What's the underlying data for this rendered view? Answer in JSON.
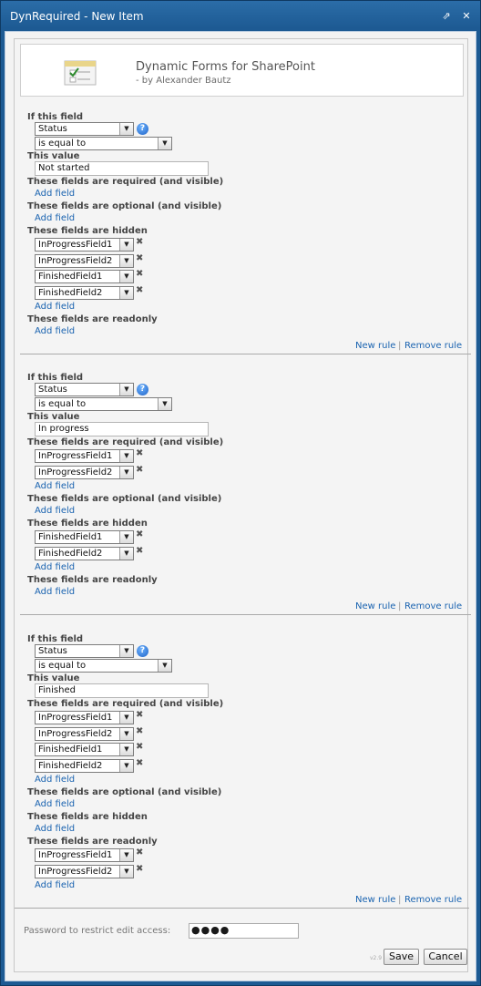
{
  "window": {
    "title": "DynRequired - New Item"
  },
  "banner": {
    "title": "Dynamic Forms for SharePoint",
    "subtitle": "- by Alexander Bautz"
  },
  "labels": {
    "if_field": "If this field",
    "this_value": "This value",
    "required": "These fields are required (and visible)",
    "optional": "These fields are optional (and visible)",
    "hidden": "These fields are hidden",
    "readonly": "These fields are readonly",
    "add_field": "Add field",
    "new_rule": "New rule",
    "remove_rule": "Remove rule",
    "sep": "|"
  },
  "icons": {
    "help": "?",
    "remove": "✖",
    "dropdown": "▼",
    "popout": "⇗",
    "close": "✕"
  },
  "rules": [
    {
      "field": "Status",
      "operator": "is equal to",
      "value": "Not started",
      "required": [],
      "optional": [],
      "hidden": [
        "InProgressField1",
        "InProgressField2",
        "FinishedField1",
        "FinishedField2"
      ],
      "readonly": []
    },
    {
      "field": "Status",
      "operator": "is equal to",
      "value": "In progress",
      "required": [
        "InProgressField1",
        "InProgressField2"
      ],
      "optional": [],
      "hidden": [
        "FinishedField1",
        "FinishedField2"
      ],
      "readonly": []
    },
    {
      "field": "Status",
      "operator": "is equal to",
      "value": "Finished",
      "required": [
        "InProgressField1",
        "InProgressField2",
        "FinishedField1",
        "FinishedField2"
      ],
      "optional": [],
      "hidden": [],
      "readonly": [
        "InProgressField1",
        "InProgressField2"
      ]
    }
  ],
  "password": {
    "label": "Password to restrict edit access:",
    "value": "●●●●"
  },
  "version": "v2.9",
  "buttons": {
    "save": "Save",
    "cancel": "Cancel"
  }
}
